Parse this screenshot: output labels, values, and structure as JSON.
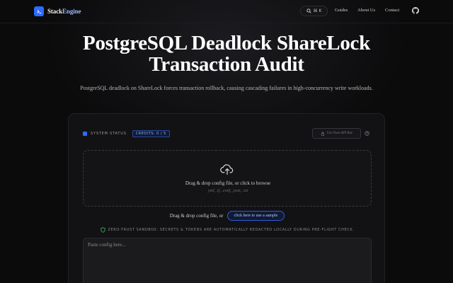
{
  "brand": {
    "name_part1": "Stack",
    "name_part2": "Engine"
  },
  "header": {
    "search_shortcut": "⌘ K",
    "nav": [
      "Guides",
      "About Us",
      "Contact"
    ]
  },
  "hero": {
    "title": "PostgreSQL Deadlock ShareLock Transaction Audit",
    "subtitle": "PostgreSQL deadlock on ShareLock forces transaction rollback, causing cascading failures in high-concurrency write workloads."
  },
  "panel": {
    "status_label": "SYSTEM STATUS",
    "credits": "CREDITS: 0 / 5",
    "api_key_button": "Use Own API Key",
    "dropzone_title": "Drag & drop config file, or click to browse",
    "dropzone_formats": "yml, .tf, .conf, .json, .txt",
    "sample_prompt": "Drag & drop config file, or",
    "sample_button": "click here to use a sample",
    "notice": "ZERO-TRUST SANDBOX: SECRETS & TOKENS ARE AUTOMATICALLY REDACTED LOCALLY DURING PRE-FLIGHT CHECK.",
    "textarea_placeholder": "Paste config here..."
  },
  "colors": {
    "accent": "#2f6bff",
    "background": "#0b0b0c",
    "notice_shield": "#3ecf6e"
  }
}
